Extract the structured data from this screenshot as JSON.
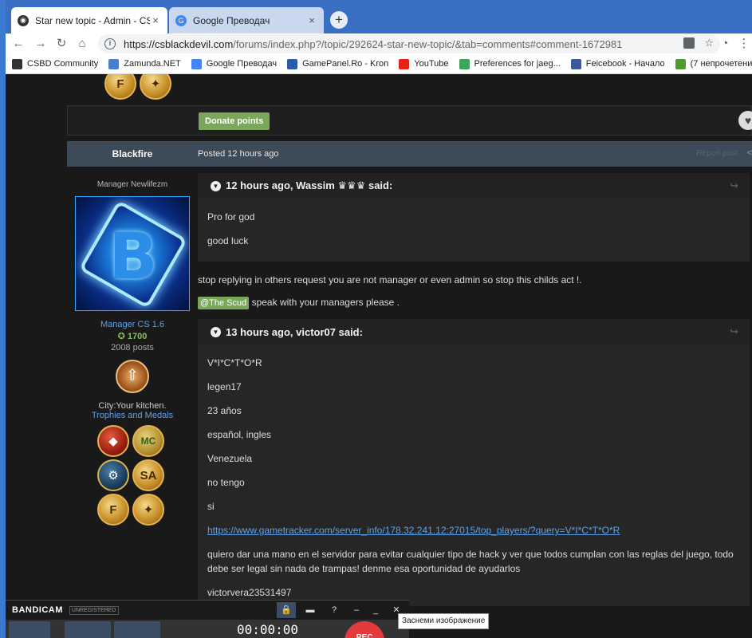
{
  "browser": {
    "tabs": [
      {
        "title": "Star new topic - Admin - CSBD C",
        "close": "×"
      },
      {
        "title": "Google Преводач",
        "close": "×"
      }
    ],
    "new_tab": "+",
    "url_main": "https://csblackdevil.com",
    "url_rest": "/forums/index.php?/topic/292624-star-new-topic/&tab=comments#comment-1672981",
    "info_icon": "i",
    "star_icon": "☆",
    "bookmarks": [
      {
        "label": "CSBD Community",
        "color": "#333333"
      },
      {
        "label": "Zamunda.NET",
        "color": "#4a7fd0"
      },
      {
        "label": "Google Преводач",
        "color": "#4285f4"
      },
      {
        "label": "GamePanel.Ro - Kron",
        "color": "#2b5aa8"
      },
      {
        "label": "YouTube",
        "color": "#e62117"
      },
      {
        "label": "Preferences for jaeg...",
        "color": "#3aa55c"
      },
      {
        "label": "Feicebook - Начало",
        "color": "#3b5998"
      },
      {
        "label": "(7 непрочетени) - A",
        "color": "#4e9a2e"
      }
    ]
  },
  "page": {
    "donate_label": "Donate points",
    "heart_icon": "♥",
    "post": {
      "author": "Blackfire",
      "date": "Posted 12 hours ago",
      "report": "Report post",
      "share_icon": "<",
      "author_title": "Manager Newlifezm",
      "avatar_letter": "B",
      "group": "Manager CS 1.6",
      "reputation": "✪ 1700",
      "posts": "2008 posts",
      "rank_icon": "⇧",
      "city": "City:Your kitchen.",
      "trophies": "Trophies and Medals",
      "medals": [
        {
          "label": "◆",
          "kind": "dota"
        },
        {
          "label": "MC",
          "kind": "mc"
        },
        {
          "label": "⚙",
          "kind": "steam"
        },
        {
          "label": "SA",
          "kind": "gold"
        },
        {
          "label": "F",
          "kind": "gold"
        },
        {
          "label": "✦",
          "kind": "gold"
        }
      ],
      "quote1": {
        "header": "12 hours ago, Wassim ♛♛♛ said:",
        "lines": [
          "Pro for god",
          "good luck"
        ]
      },
      "reply_line": "stop replying in others request you are not manager or even admin so stop this childs act !.",
      "mention": "@The Scud",
      "mention_after": " speak with your managers please .",
      "quote2": {
        "header": "13 hours ago, victor07 said:",
        "lines": [
          "V*I*C*T*O*R",
          "legen17",
          "23 años",
          "español, ingles",
          "Venezuela",
          "no tengo",
          "si"
        ],
        "link": "https://www.gametracker.com/server_info/178.32.241.12:27015/top_players/?query=V*I*C*T*O*R",
        "paragraph": "quiero dar una mano en el servidor para evitar cualquier tipo de hack y ver que todos cumplan con las reglas del juego, todo debe ser legal sin nada de trampas! denme esa oportunidad de ayudarlos",
        "last": "victorvera23531497"
      }
    },
    "top_medals": [
      {
        "label": "F"
      },
      {
        "label": "✦"
      }
    ]
  },
  "bandicam": {
    "logo": "BANDICAM",
    "unregistered": "UNREGISTERED",
    "lock_icon": "🔒",
    "folder_icon": "▬",
    "help_icon": "?",
    "min_icon": "–",
    "max_icon": "_",
    "close_icon": "✕",
    "timer": "00:00:00",
    "rec": "REC",
    "tooltip": "Заснеми изображение"
  }
}
